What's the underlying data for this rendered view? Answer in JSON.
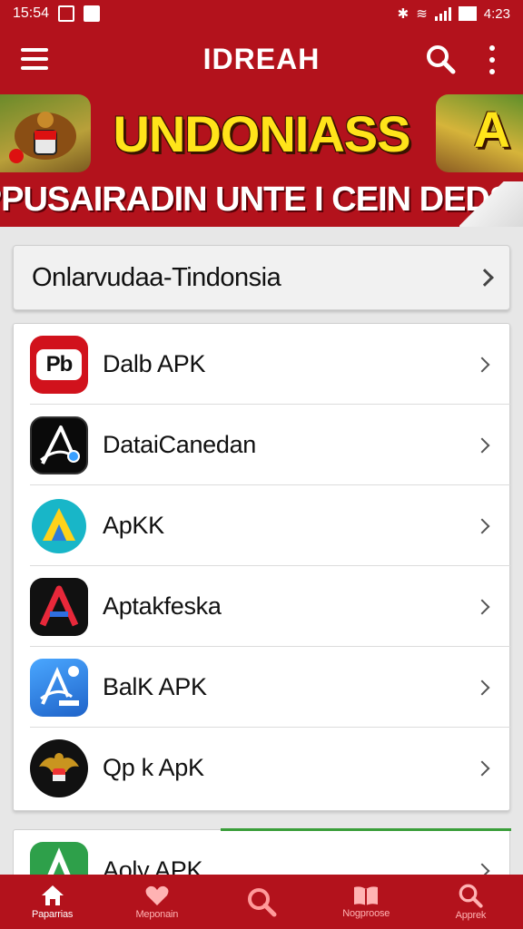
{
  "status_bar": {
    "time": "15:54",
    "right_text": "4:23"
  },
  "app_bar": {
    "title": "IDREAH"
  },
  "banner": {
    "heading": "UNDONIASS",
    "heading_letter": "A",
    "subheading": "PPUSAIRADIN UNTE I CEIN DEDSIN"
  },
  "section": {
    "title": "Onlarvudaa-Tindonsia"
  },
  "apps": [
    {
      "label": "Dalb APK",
      "icon": "pb-logo-icon",
      "icon_text": "Pb"
    },
    {
      "label": "DataiCanedan",
      "icon": "a-logo-icon",
      "icon_text": "A"
    },
    {
      "label": "ApKK",
      "icon": "gradient-a-icon",
      "icon_text": "A"
    },
    {
      "label": "Aptakfeska",
      "icon": "dark-a-icon",
      "icon_text": "A"
    },
    {
      "label": "BalK APK",
      "icon": "blue-a-icon",
      "icon_text": "A"
    },
    {
      "label": "Qp k ApK",
      "icon": "garuda-emblem-icon",
      "icon_text": ""
    }
  ],
  "second_list": {
    "label": "Aoly APK",
    "icon": "green-a-icon"
  },
  "bottom_nav": [
    {
      "label": "Paparrias",
      "icon": "home-icon",
      "active": true
    },
    {
      "label": "Meponain",
      "icon": "heart-icon",
      "active": false
    },
    {
      "label": "",
      "icon": "search-icon",
      "active": false
    },
    {
      "label": "Nogproose",
      "icon": "book-icon",
      "active": false
    },
    {
      "label": "Apprek",
      "icon": "search-icon",
      "active": false
    }
  ],
  "colors": {
    "primary": "#b3121c",
    "accent_yellow": "#ffe41a",
    "background": "#e7e7e7"
  }
}
